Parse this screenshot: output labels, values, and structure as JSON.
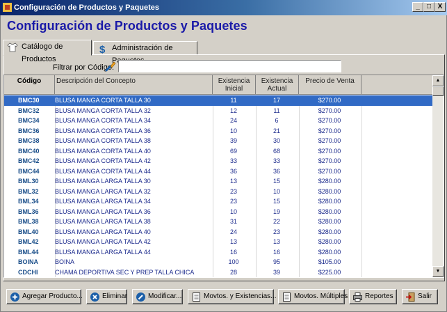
{
  "window": {
    "title": "Configuración de Productos y Paquetes",
    "controls": [
      "_",
      "□",
      "X"
    ]
  },
  "page_title": "Configuración de Productos y Paquetes",
  "tabs": [
    {
      "label": "Catálogo de Productos",
      "icon": "shirt-icon",
      "active": true
    },
    {
      "label": "Administración de Paquetes",
      "icon": "dollar-icon",
      "active": false
    }
  ],
  "filter": {
    "label": "Filtrar por Código:",
    "value": "",
    "placeholder": ""
  },
  "grid": {
    "headers": {
      "code": "Código",
      "description": "Descripción del Concepto",
      "initial_1": "Existencia",
      "initial_2": "Inicial",
      "current_1": "Existencia",
      "current_2": "Actual",
      "price": "Precio de Venta"
    },
    "rows": [
      {
        "code": "BMC30",
        "desc": "BLUSA MANGA CORTA TALLA 30",
        "initial": "11",
        "current": "17",
        "price": "$270.00",
        "selected": true
      },
      {
        "code": "BMC32",
        "desc": "BLUSA MANGA CORTA TALLA 32",
        "initial": "12",
        "current": "11",
        "price": "$270.00"
      },
      {
        "code": "BMC34",
        "desc": "BLUSA MANGA CORTA TALLA 34",
        "initial": "24",
        "current": "6",
        "price": "$270.00"
      },
      {
        "code": "BMC36",
        "desc": "BLUSA MANGA CORTA TALLA 36",
        "initial": "10",
        "current": "21",
        "price": "$270.00"
      },
      {
        "code": "BMC38",
        "desc": "BLUSA MANGA CORTA TALLA 38",
        "initial": "39",
        "current": "30",
        "price": "$270.00"
      },
      {
        "code": "BMC40",
        "desc": "BLUSA MANGA CORTA TALLA 40",
        "initial": "69",
        "current": "68",
        "price": "$270.00"
      },
      {
        "code": "BMC42",
        "desc": "BLUSA MANGA CORTA TALLA 42",
        "initial": "33",
        "current": "33",
        "price": "$270.00"
      },
      {
        "code": "BMC44",
        "desc": "BLUSA MANGA CORTA TALLA 44",
        "initial": "36",
        "current": "36",
        "price": "$270.00"
      },
      {
        "code": "BML30",
        "desc": "BLUSA MANGA LARGA TALLA 30",
        "initial": "13",
        "current": "15",
        "price": "$280.00"
      },
      {
        "code": "BML32",
        "desc": "BLUSA MANGA LARGA TALLA 32",
        "initial": "23",
        "current": "10",
        "price": "$280.00"
      },
      {
        "code": "BML34",
        "desc": "BLUSA MANGA LARGA TALLA 34",
        "initial": "23",
        "current": "15",
        "price": "$280.00"
      },
      {
        "code": "BML36",
        "desc": "BLUSA MANGA LARGA TALLA 36",
        "initial": "10",
        "current": "19",
        "price": "$280.00"
      },
      {
        "code": "BML38",
        "desc": "BLUSA MANGA LARGA TALLA 38",
        "initial": "31",
        "current": "22",
        "price": "$280.00"
      },
      {
        "code": "BML40",
        "desc": "BLUSA MANGA LARGA TALLA 40",
        "initial": "24",
        "current": "23",
        "price": "$280.00"
      },
      {
        "code": "BML42",
        "desc": "BLUSA MANGA LARGA TALLA 42",
        "initial": "13",
        "current": "13",
        "price": "$280.00"
      },
      {
        "code": "BML44",
        "desc": "BLUSA MANGA LARGA TALLA 44",
        "initial": "16",
        "current": "16",
        "price": "$280.00"
      },
      {
        "code": "BOINA",
        "desc": "BOINA",
        "initial": "100",
        "current": "95",
        "price": "$105.00"
      },
      {
        "code": "CDCHI",
        "desc": "CHAMA DEPORTIVA SEC Y PREP TALLA CHICA",
        "initial": "28",
        "current": "39",
        "price": "$225.00"
      }
    ]
  },
  "toolbar": {
    "add": "Agregar Producto...",
    "delete": "Eliminar",
    "modify": "Modificar...",
    "movements": "Movtos. y Existencias...",
    "multi": "Movtos. Múltiples",
    "reports": "Reportes",
    "exit": "Salir"
  },
  "colors": {
    "title": "#1a1aa8",
    "selection": "#316ac5",
    "titlebar": "#0a246a"
  }
}
